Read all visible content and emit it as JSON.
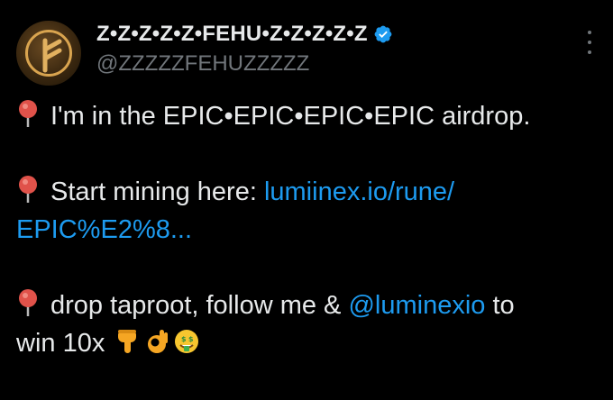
{
  "tweet": {
    "display_name": "Z•Z•Z•Z•Z•FEHU•Z•Z•Z•Z•Z",
    "handle": "@ZZZZZFEHUZZZZZ",
    "verified": true,
    "verified_color": "#1d9bf0",
    "link_color": "#1d9bf0",
    "line1_text": "I'm in the EPIC•EPIC•EPIC•EPIC airdrop.",
    "line2_text": "Start mining here: ",
    "line2_link": "lumiinex.io/rune/",
    "line2_link_cont": "EPIC%E2%8...",
    "line3_text_a": "drop taproot, follow me & ",
    "line3_mention": "@luminexio",
    "line3_text_b": " to",
    "line3_text_c": "win 10x",
    "icons": {
      "avatar": "fehu-rune-avatar",
      "bullet": "round-pushpin-emoji",
      "emojis": [
        "backhand-index-pointing-down",
        "ok-hand",
        "money-mouth-face"
      ]
    }
  }
}
